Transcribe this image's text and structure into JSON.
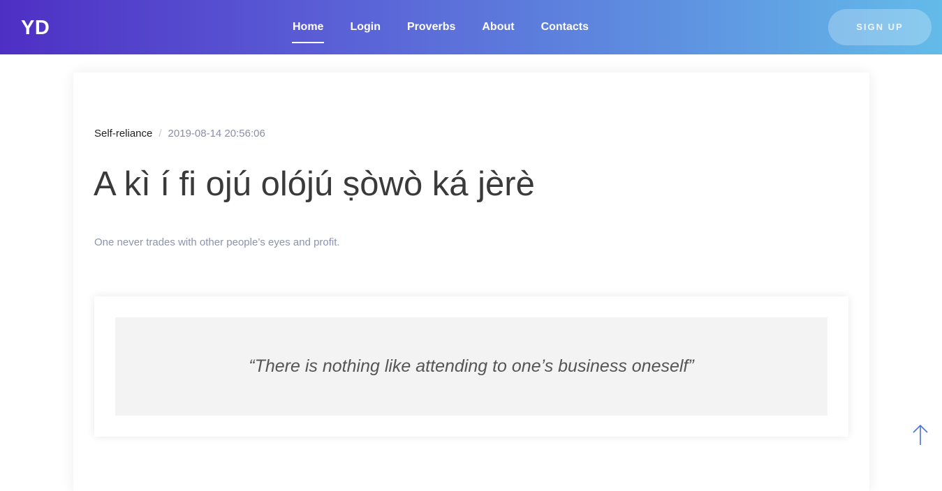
{
  "navbar": {
    "brand": "YD",
    "links": [
      {
        "label": "Home",
        "active": true
      },
      {
        "label": "Login"
      },
      {
        "label": "Proverbs"
      },
      {
        "label": "About"
      },
      {
        "label": "Contacts"
      }
    ],
    "signup_label": "SIGN UP"
  },
  "post": {
    "category": "Self-reliance",
    "separator": "/",
    "date": "2019-08-14 20:56:06",
    "title": "A kì í fi ojú olójú ṣòwò ká jèrè",
    "translation": "One never trades with other people’s eyes and profit.",
    "quote": "“There is nothing like attending to one’s business oneself”"
  },
  "icons": {
    "back_to_top": "arrow-up-icon"
  },
  "colors": {
    "nav_gradient_start": "#4e2fc4",
    "nav_gradient_end": "#63bbe9",
    "arrow": "#4a6fdc"
  }
}
